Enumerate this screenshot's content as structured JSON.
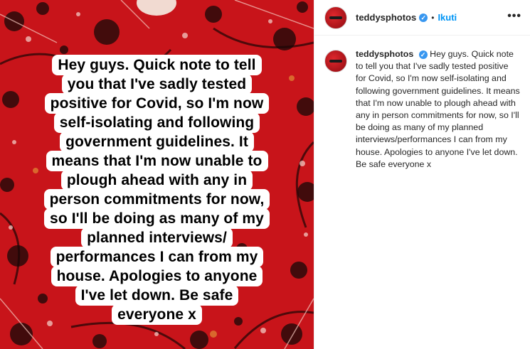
{
  "post": {
    "username": "teddysphotos",
    "verified_icon": "verified-badge-icon",
    "separator": "•",
    "follow_label": "Ikuti",
    "more_label": "•••",
    "caption": "Hey guys. Quick note to tell you that I've sadly tested positive for Covid, so I'm now self-isolating and following government guidelines. It means that I'm now unable to plough ahead with any in person commitments for now, so I'll be doing as many of my planned interviews/performances I can from my house. Apologies to anyone I've let down. Be safe everyone x"
  },
  "image": {
    "background_color": "#c8141a",
    "lines": [
      "Hey guys. Quick note to tell",
      "you that I've sadly tested",
      "positive for Covid, so I'm now",
      "self-isolating and following",
      "government guidelines. It",
      "means that I'm now unable to",
      "plough ahead with any in",
      "person commitments for now,",
      "so I'll be doing as many of my",
      "planned interviews/",
      "performances I can from my",
      "house. Apologies to anyone",
      "I've let down. Be safe",
      "everyone x"
    ]
  },
  "colors": {
    "accent": "#0095f6",
    "verified": "#3897f0",
    "text": "#262626"
  }
}
